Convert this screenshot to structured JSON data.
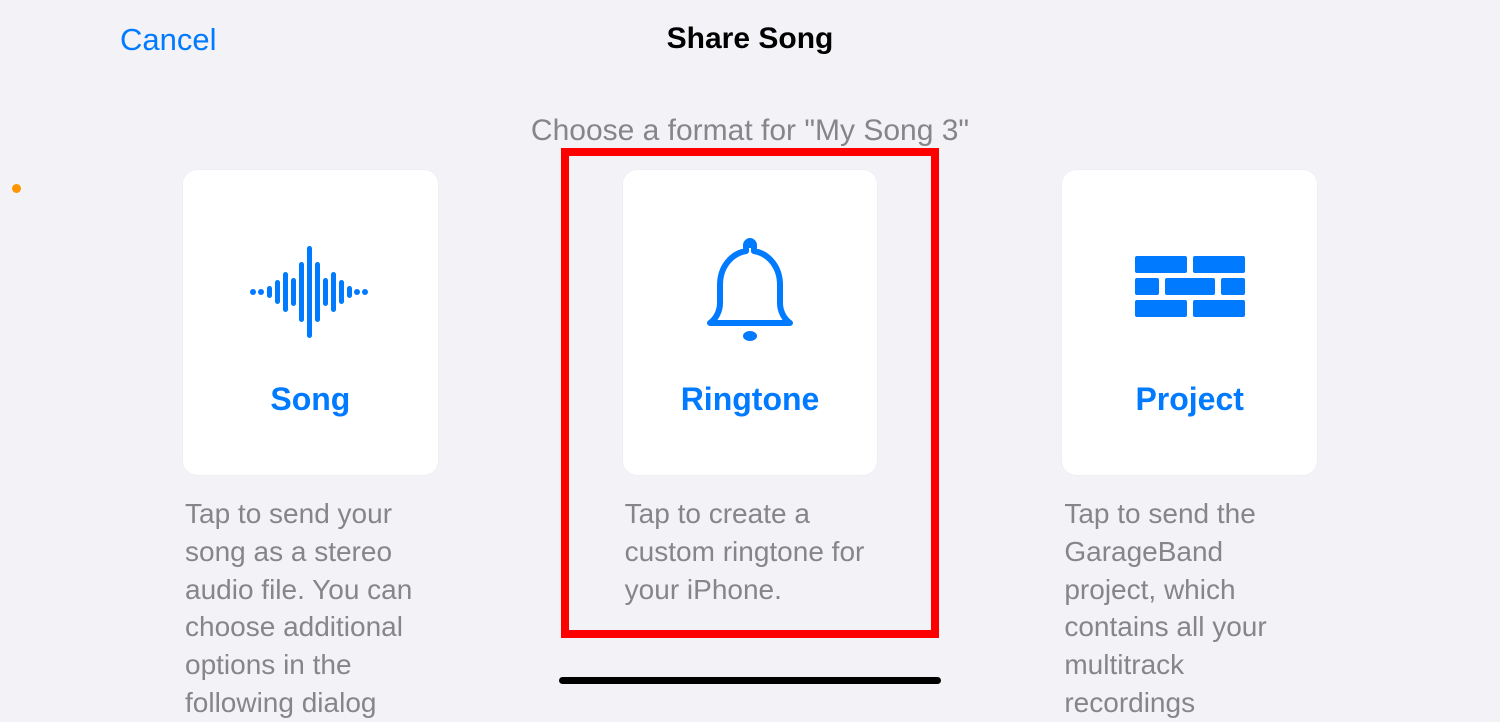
{
  "header": {
    "cancel_label": "Cancel",
    "title": "Share Song"
  },
  "subtitle": "Choose a format for \"My Song 3\"",
  "options": {
    "song": {
      "label": "Song",
      "description": "Tap to send your song as a stereo audio file. You can choose additional options in the following dialog"
    },
    "ringtone": {
      "label": "Ringtone",
      "description": "Tap to create a custom ringtone for your iPhone."
    },
    "project": {
      "label": "Project",
      "description": "Tap to send the GarageBand project, which contains all your multitrack recordings"
    }
  },
  "highlighted_option": "ringtone"
}
